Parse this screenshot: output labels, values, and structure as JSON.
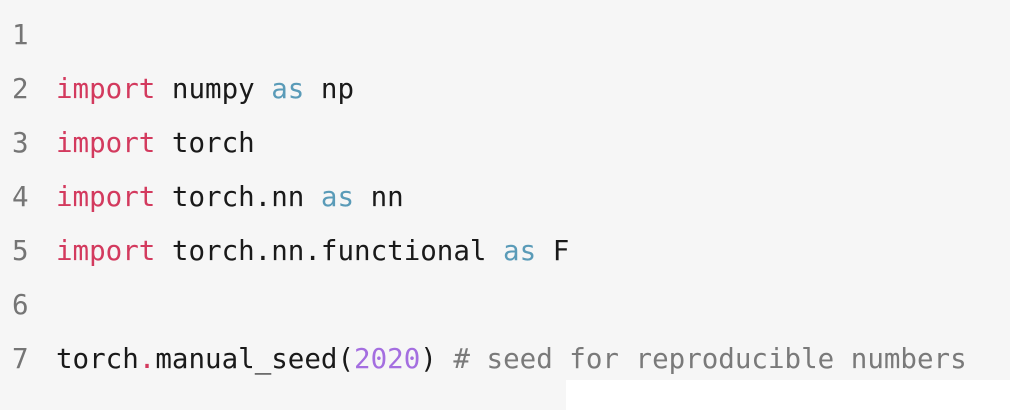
{
  "colors": {
    "background": "#f6f6f6",
    "keyword": "#d33a5e",
    "as_keyword": "#5a9bb8",
    "number": "#a46ee0",
    "comment": "#7a7a7a",
    "line_number": "#757575",
    "text": "#1a1a1a"
  },
  "code": {
    "lines": [
      {
        "number": "1",
        "tokens": []
      },
      {
        "number": "2",
        "tokens": [
          {
            "type": "kw",
            "text": "import"
          },
          {
            "type": "plain",
            "text": " numpy "
          },
          {
            "type": "as",
            "text": "as"
          },
          {
            "type": "plain",
            "text": " np"
          }
        ]
      },
      {
        "number": "3",
        "tokens": [
          {
            "type": "kw",
            "text": "import"
          },
          {
            "type": "plain",
            "text": " torch"
          }
        ]
      },
      {
        "number": "4",
        "tokens": [
          {
            "type": "kw",
            "text": "import"
          },
          {
            "type": "plain",
            "text": " torch.nn "
          },
          {
            "type": "as",
            "text": "as"
          },
          {
            "type": "plain",
            "text": " nn"
          }
        ]
      },
      {
        "number": "5",
        "tokens": [
          {
            "type": "kw",
            "text": "import"
          },
          {
            "type": "plain",
            "text": " torch.nn.functional "
          },
          {
            "type": "as",
            "text": "as"
          },
          {
            "type": "plain",
            "text": " F"
          }
        ]
      },
      {
        "number": "6",
        "tokens": []
      },
      {
        "number": "7",
        "tokens": [
          {
            "type": "plain",
            "text": "torch"
          },
          {
            "type": "kw",
            "text": "."
          },
          {
            "type": "plain",
            "text": "manual_seed("
          },
          {
            "type": "num",
            "text": "2020"
          },
          {
            "type": "plain",
            "text": ") "
          },
          {
            "type": "comment",
            "text": "# seed for reproducible numbers"
          }
        ]
      }
    ]
  }
}
